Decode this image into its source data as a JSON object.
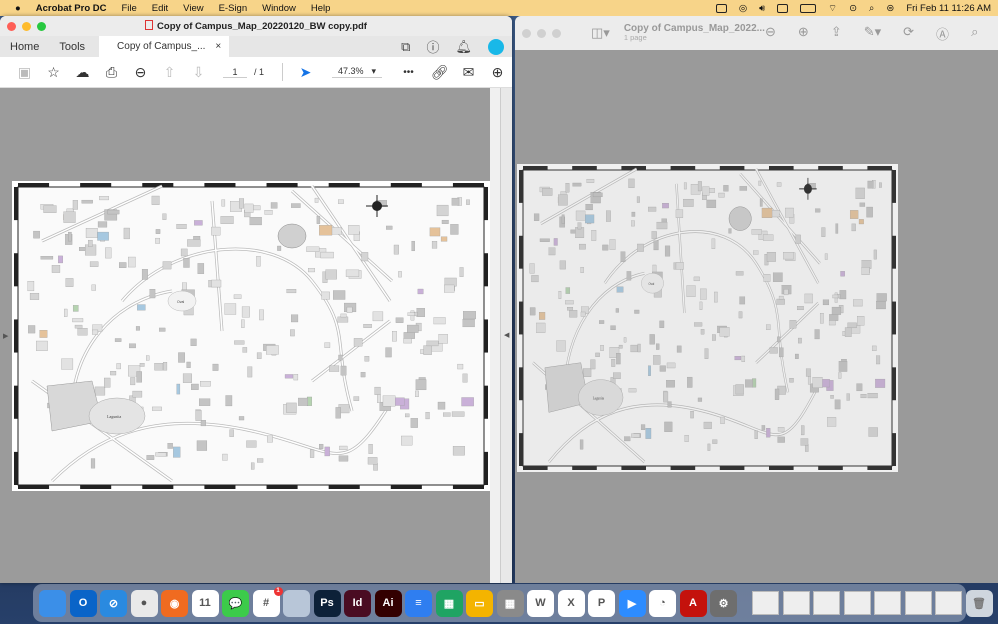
{
  "menubar": {
    "app": "Acrobat Pro DC",
    "items": [
      "File",
      "Edit",
      "View",
      "E-Sign",
      "Window",
      "Help"
    ],
    "clock": "Fri Feb 11  11:26 AM"
  },
  "acrobat": {
    "title": "Copy of Campus_Map_20220120_BW copy.pdf",
    "nav": [
      "Home",
      "Tools"
    ],
    "tab": "Copy of Campus_...",
    "close": "×",
    "page_current": "1",
    "page_total": "/ 1",
    "zoom": "47.3%",
    "more": "•••"
  },
  "preview": {
    "title": "Copy of Campus_Map_2022...",
    "subtitle": "1 page"
  },
  "map": {
    "labels": [
      "Lagunita",
      "Oval"
    ],
    "colors": {
      "accent": "#19b8e8"
    }
  },
  "dock": {
    "apps": [
      {
        "name": "finder",
        "label": "",
        "color": "#3b8fe8"
      },
      {
        "name": "outlook",
        "label": "O",
        "color": "#0a64c8"
      },
      {
        "name": "safari",
        "label": "⊘",
        "color": "#2a8ae0"
      },
      {
        "name": "chrome",
        "label": "●",
        "color": "#e9e9e9"
      },
      {
        "name": "firefox",
        "label": "◉",
        "color": "#f06b20"
      },
      {
        "name": "calendar",
        "label": "11",
        "color": "#ffffff"
      },
      {
        "name": "messages",
        "label": "💬",
        "color": "#3ccb4a"
      },
      {
        "name": "slack",
        "label": "#",
        "color": "#ffffff",
        "badge": "1"
      },
      {
        "name": "preview",
        "label": "",
        "color": "#b8c6d8"
      },
      {
        "name": "photoshop",
        "label": "Ps",
        "color": "#0d2138"
      },
      {
        "name": "indesign",
        "label": "Id",
        "color": "#4a0c22"
      },
      {
        "name": "illustrator",
        "label": "Ai",
        "color": "#330000"
      },
      {
        "name": "google-docs",
        "label": "≡",
        "color": "#2f7ef0"
      },
      {
        "name": "google-sheets",
        "label": "▦",
        "color": "#1fa463"
      },
      {
        "name": "google-slides",
        "label": "▭",
        "color": "#f4b400"
      },
      {
        "name": "calculator",
        "label": "▦",
        "color": "#8a8a8a"
      },
      {
        "name": "word",
        "label": "W",
        "color": "#ffffff"
      },
      {
        "name": "excel",
        "label": "X",
        "color": "#ffffff"
      },
      {
        "name": "powerpoint",
        "label": "P",
        "color": "#ffffff"
      },
      {
        "name": "zoom",
        "label": "▶",
        "color": "#2d8cff"
      },
      {
        "name": "webex",
        "label": "◔",
        "color": "#ffffff"
      },
      {
        "name": "acrobat",
        "label": "A",
        "color": "#c4120c"
      },
      {
        "name": "system-preferences",
        "label": "⚙",
        "color": "#6e6e6e"
      }
    ]
  }
}
